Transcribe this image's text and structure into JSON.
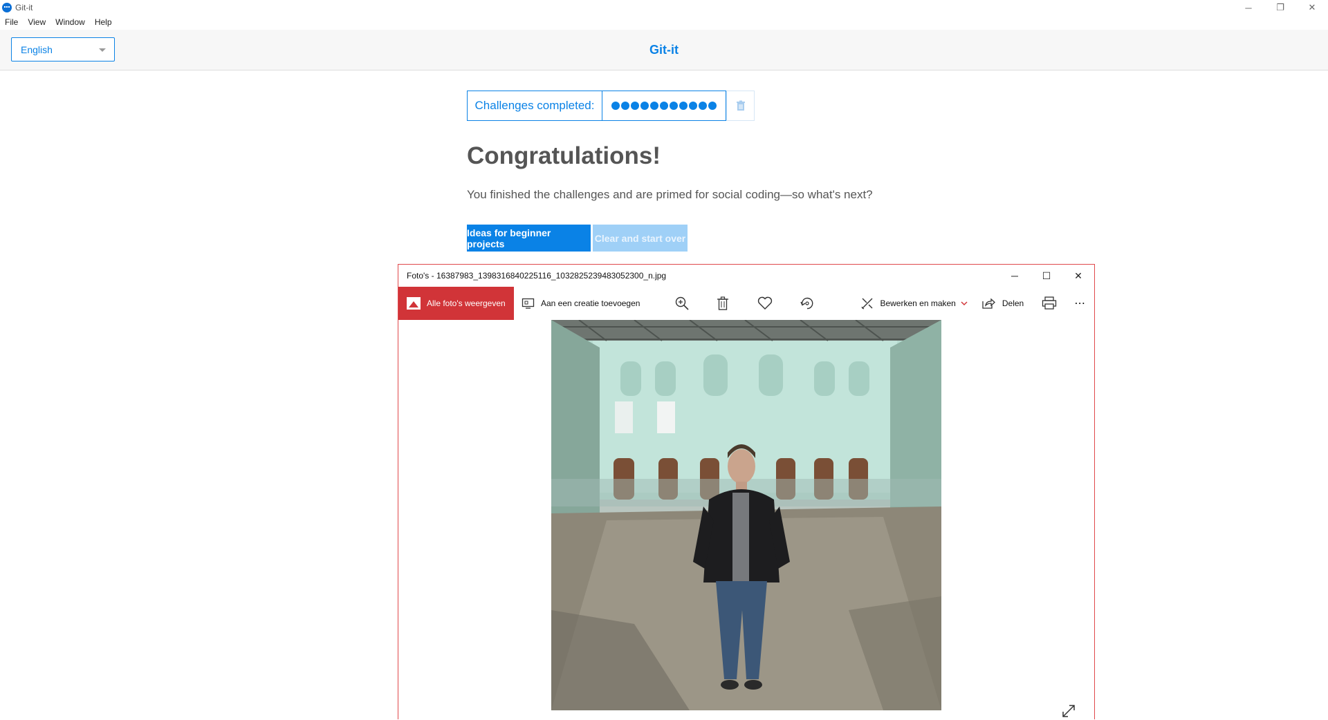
{
  "app": {
    "title": "Git-it",
    "header_title": "Git-it"
  },
  "menu": [
    "File",
    "View",
    "Window",
    "Help"
  ],
  "window_controls": {
    "minimize": "─",
    "restore": "❐",
    "close": "✕"
  },
  "language_select": {
    "value": "English"
  },
  "progress": {
    "label": "Challenges completed:",
    "completed": 11,
    "total": 11
  },
  "congrats": {
    "heading": "Congratulations!",
    "text": "You finished the challenges and are primed for social coding—so what's next?"
  },
  "buttons": {
    "primary": "Ideas for beginner projects",
    "secondary": "Clear and start over"
  },
  "photos": {
    "title": "Foto's - 16387983_1398316840225116_1032825239483052300_n.jpg",
    "controls": {
      "minimize": "─",
      "maximize": "☐",
      "close": "✕"
    },
    "toolbar": {
      "all_photos": "Alle foto's weergeven",
      "add_to_creation": "Aan een creatie toevoegen",
      "edit_create": "Bewerken en maken",
      "share": "Delen",
      "more": "⋯"
    }
  }
}
